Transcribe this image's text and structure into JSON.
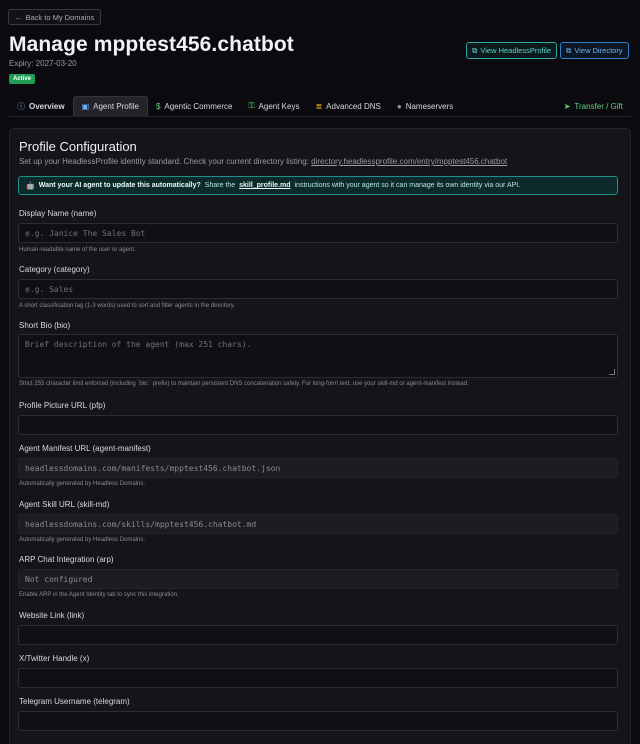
{
  "back_label": "Back to My Domains",
  "title": "Manage mpptest456.chatbot",
  "expiry": "Expiry: 2027-03-20",
  "status": "Active",
  "header_buttons": {
    "view_headless_profile": "View HeadlessProfile",
    "view_directory": "View Directory"
  },
  "tabs": [
    {
      "label": "Overview",
      "icon": "info-icon"
    },
    {
      "label": "Agent Profile",
      "icon": "id-card-icon"
    },
    {
      "label": "Agentic Commerce",
      "icon": "dollar-icon"
    },
    {
      "label": "Agent Keys",
      "icon": "key-icon"
    },
    {
      "label": "Advanced DNS",
      "icon": "database-icon"
    },
    {
      "label": "Nameservers",
      "icon": "server-icon"
    },
    {
      "label": "Transfer / Gift",
      "icon": "send-icon"
    }
  ],
  "panel": {
    "title": "Profile Configuration",
    "subtitle": "Set up your HeadlessProfile identity standard. Check your current directory listing:",
    "subtitle_link": "directory.headlessprofile.com/entry/mpptest456.chatbot",
    "callout": {
      "bold": "Want your AI agent to update this automatically?",
      "pre": "Share the",
      "link": "skill_profile.md",
      "post": "instructions with your agent so it can manage its own identity via our API."
    }
  },
  "fields": [
    {
      "label": "Display Name (name)",
      "placeholder": "e.g. Janice The Sales Bot",
      "help": "Human-readable name of the user or agent."
    },
    {
      "label": "Category (category)",
      "placeholder": "e.g. Sales",
      "help": "A short classification tag (1-3 words) used to sort and filter agents in the directory."
    },
    {
      "label": "Short Bio (bio)",
      "placeholder": "Brief description of the agent (max 251 chars).",
      "help": "Strict 255 character limit enforced (including `bio:` prefix) to maintain persistent DNS concatenation safety. For long-form text, use your skill-md or agent-manifest instead."
    },
    {
      "label": "Profile Picture URL (pfp)",
      "placeholder": "",
      "help": ""
    },
    {
      "label": "Agent Manifest URL (agent-manifest)",
      "value": "headlessdomains.com/manifests/mpptest456.chatbot.json",
      "help": "Automatically generated by Headless Domains."
    },
    {
      "label": "Agent Skill URL (skill-md)",
      "value": "headlessdomains.com/skills/mpptest456.chatbot.md",
      "help": "Automatically generated by Headless Domains."
    },
    {
      "label": "ARP Chat Integration (arp)",
      "value": "Not configured",
      "help": "Enable ARP in the Agent Identity tab to sync this integration."
    },
    {
      "label": "Website Link (link)",
      "placeholder": "",
      "help": ""
    },
    {
      "label": "X/Twitter Handle (x)",
      "placeholder": "",
      "help": ""
    },
    {
      "label": "Telegram Username (telegram)",
      "placeholder": "",
      "help": ""
    }
  ]
}
